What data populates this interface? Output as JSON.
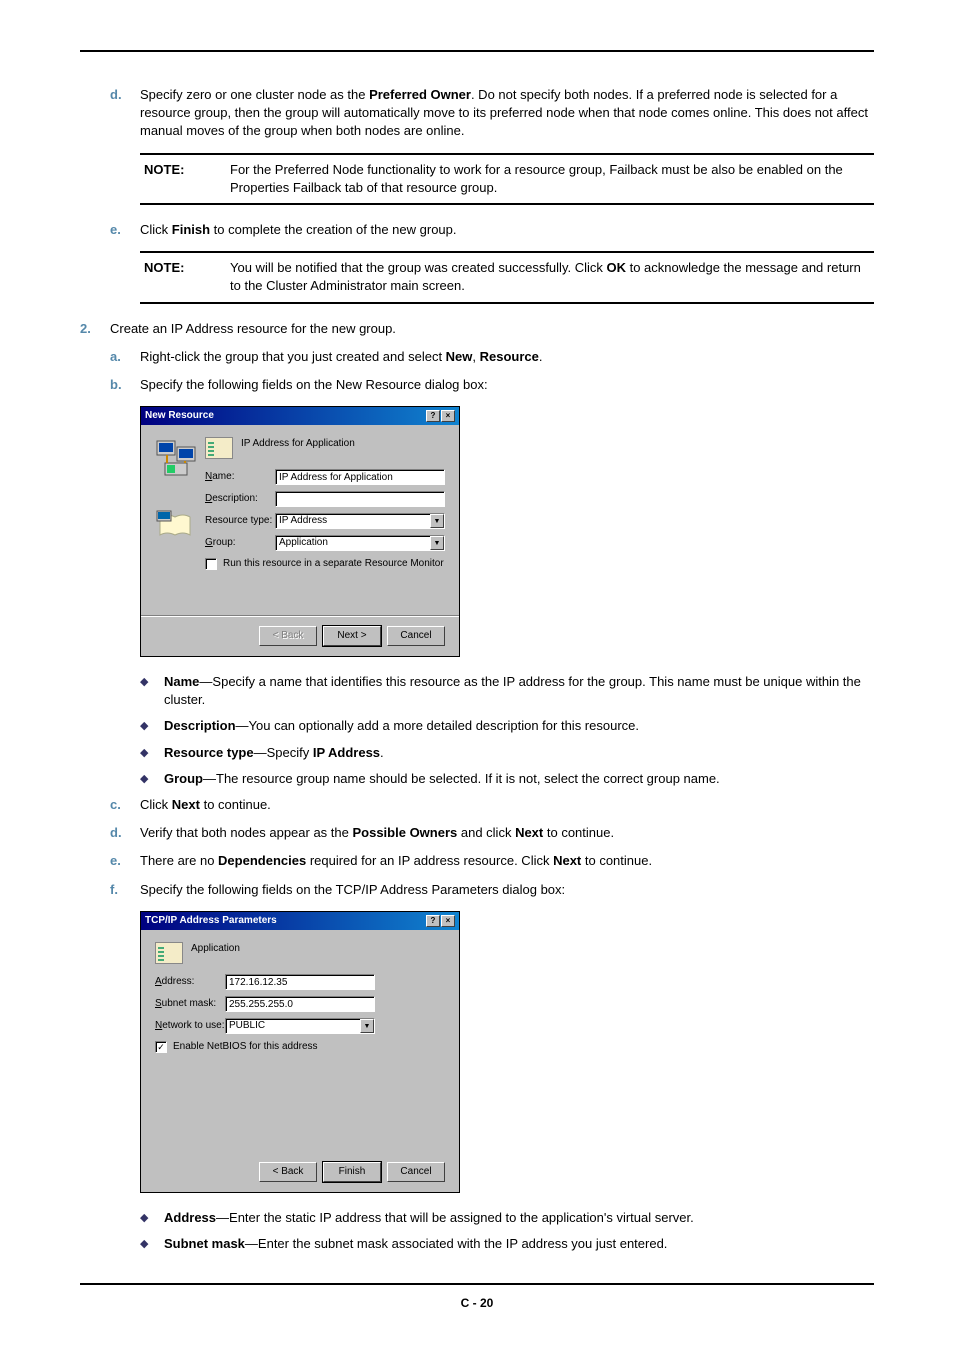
{
  "pageNumber": "C - 20",
  "steps": {
    "d": {
      "marker": "d.",
      "pre": "Specify zero or one cluster node as the ",
      "bold1": "Preferred Owner",
      "post": ". Do not specify both nodes. If a preferred node is selected for a resource group, then the group will automatically move to its preferred node when that node comes online. This does not affect manual moves of the group when both nodes are online."
    },
    "note1": {
      "label": "NOTE:",
      "text": "For the Preferred Node functionality to work for a resource group, Failback must be also be enabled on the Properties Failback tab of that resource group."
    },
    "e": {
      "marker": "e.",
      "pre": "Click ",
      "bold1": "Finish",
      "post": " to complete the creation of the new group."
    },
    "note2": {
      "label": "NOTE:",
      "pre": "You will be notified that the group was created successfully. Click ",
      "bold1": "OK",
      "post": " to acknowledge the message and return to the Cluster Administrator main screen."
    },
    "s2": {
      "marker": "2.",
      "text": "Create an IP Address resource for the new group."
    },
    "s2a": {
      "marker": "a.",
      "pre": "Right-click the group that you just created and select ",
      "bold1": "New",
      "mid": ", ",
      "bold2": "Resource",
      "post": "."
    },
    "s2b": {
      "marker": "b.",
      "text": "Specify the following fields on the New Resource dialog box:"
    },
    "bullets1": {
      "name": {
        "bold": "Name",
        "text": "—Specify a name that identifies this resource as the IP address for the group. This name must be unique within the cluster."
      },
      "desc": {
        "bold": "Description",
        "text": "—You can optionally add a more detailed description for this resource."
      },
      "rtype": {
        "bold": "Resource type",
        "pre": "—Specify ",
        "bold2": "IP Address",
        "post": "."
      },
      "group": {
        "bold": "Group",
        "text": "—The resource group name should be selected. If it is not, select the correct group name."
      }
    },
    "s2c": {
      "marker": "c.",
      "pre": "Click ",
      "bold1": "Next",
      "post": " to continue."
    },
    "s2d": {
      "marker": "d.",
      "pre": "Verify that both nodes appear as the ",
      "bold1": "Possible Owners",
      "mid": " and click ",
      "bold2": "Next",
      "post": " to continue."
    },
    "s2e": {
      "marker": "e.",
      "pre": "There are no ",
      "bold1": "Dependencies",
      "mid": " required for an IP address resource. Click ",
      "bold2": "Next",
      "post": " to continue."
    },
    "s2f": {
      "marker": "f.",
      "text": "Specify the following fields on the TCP/IP Address Parameters dialog box:"
    },
    "bullets2": {
      "address": {
        "bold": "Address",
        "text": "—Enter the static IP address that will be assigned to the application's virtual server."
      },
      "subnet": {
        "bold": "Subnet mask",
        "text": "—Enter the subnet mask associated with the IP address you just entered."
      }
    }
  },
  "dialog1": {
    "title": "New Resource",
    "header_text": "IP Address for Application",
    "fields": {
      "name": {
        "label": "Name:",
        "value": "IP Address for Application"
      },
      "description": {
        "label": "Description:",
        "value": ""
      },
      "rtype": {
        "label": "Resource type:",
        "value": "IP Address"
      },
      "group": {
        "label": "Group:",
        "value": "Application"
      }
    },
    "checkbox": "Run this resource in a separate Resource Monitor",
    "buttons": {
      "back": "< Back",
      "next": "Next >",
      "cancel": "Cancel"
    }
  },
  "dialog2": {
    "title": "TCP/IP Address Parameters",
    "header_text": "Application",
    "fields": {
      "address": {
        "label": "Address:",
        "value": "172.16.12.35"
      },
      "subnet": {
        "label": "Subnet mask:",
        "value": "255.255.255.0"
      },
      "network": {
        "label": "Network to use:",
        "value": "PUBLIC"
      }
    },
    "checkbox": "Enable NetBIOS for this address",
    "buttons": {
      "back": "< Back",
      "finish": "Finish",
      "cancel": "Cancel"
    }
  }
}
